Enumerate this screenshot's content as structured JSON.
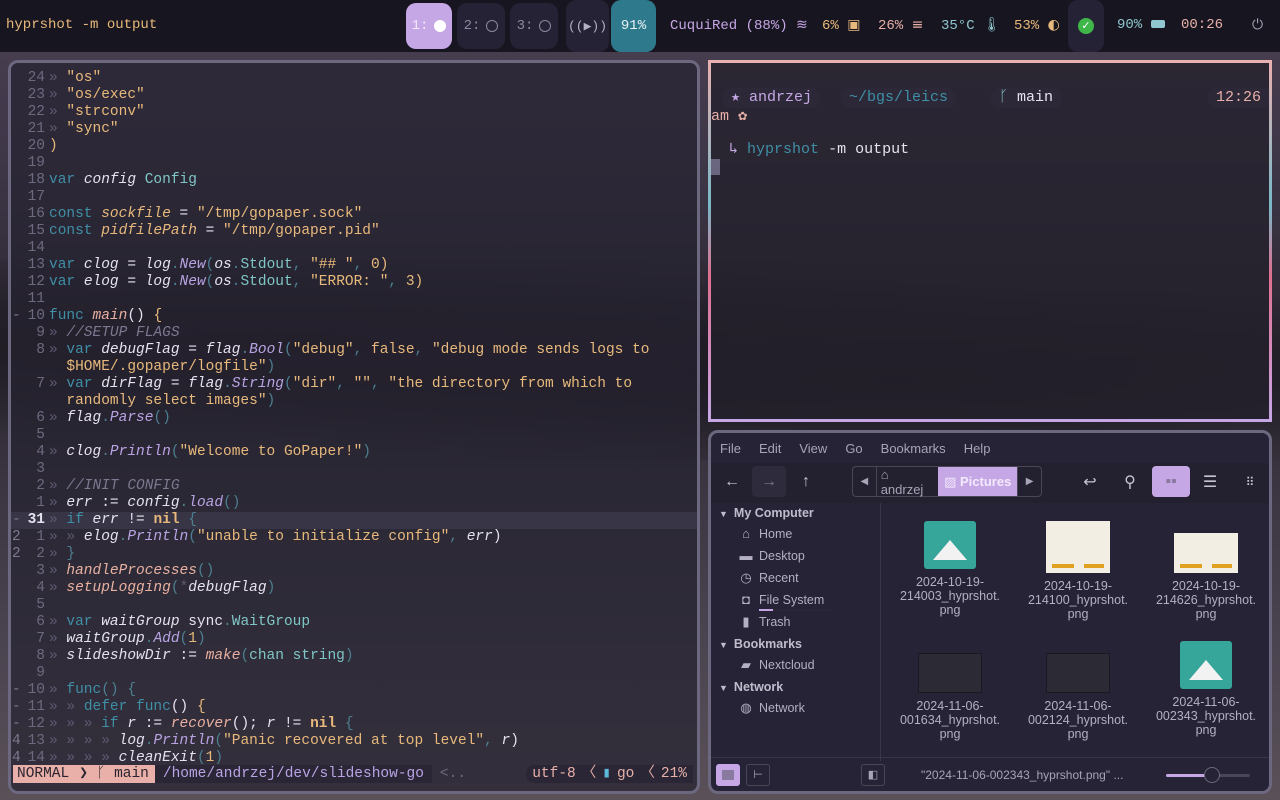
{
  "topbar": {
    "title": "hyprshot -m output",
    "workspaces": [
      {
        "label": "1:",
        "active": true
      },
      {
        "label": "2:",
        "active": false
      },
      {
        "label": "3:",
        "active": false
      }
    ],
    "media_icon": "media-play-icon",
    "volume": "91%",
    "wifi": "CuquiRed (88%)",
    "cpu": "6%",
    "memory": "26%",
    "temperature": "35°C",
    "brightness": "53%",
    "battery": "90%",
    "clock": "00:26",
    "colors": {
      "accent": "#c6a7e6",
      "volume_bg": "#2e7a8c",
      "bar_bg": "#17151f"
    }
  },
  "editor": {
    "lines": [
      {
        "n": "24",
        "f": "",
        "html": [
          [
            "arrow",
            "» "
          ],
          [
            "str",
            "\"os\""
          ]
        ]
      },
      {
        "n": "23",
        "f": "",
        "html": [
          [
            "arrow",
            "» "
          ],
          [
            "str",
            "\"os/exec\""
          ]
        ]
      },
      {
        "n": "22",
        "f": "",
        "html": [
          [
            "arrow",
            "» "
          ],
          [
            "str",
            "\"strconv\""
          ]
        ]
      },
      {
        "n": "21",
        "f": "",
        "html": [
          [
            "arrow",
            "» "
          ],
          [
            "str",
            "\"sync\""
          ]
        ]
      },
      {
        "n": "20",
        "f": "",
        "html": [
          [
            "str",
            ")"
          ]
        ]
      },
      {
        "n": "19",
        "f": "",
        "html": []
      },
      {
        "n": "18",
        "f": "",
        "html": [
          [
            "kw",
            "var "
          ],
          [
            "var",
            "config "
          ],
          [
            "typ",
            "Config"
          ]
        ]
      },
      {
        "n": "17",
        "f": "",
        "html": []
      },
      {
        "n": "16",
        "f": "",
        "html": [
          [
            "kw",
            "const "
          ],
          [
            "gl",
            "sockfile"
          ],
          [
            "txt",
            " = "
          ],
          [
            "str",
            "\"/tmp/gopaper.sock\""
          ]
        ]
      },
      {
        "n": "15",
        "f": "",
        "html": [
          [
            "kw",
            "const "
          ],
          [
            "gl",
            "pidfilePath"
          ],
          [
            "txt",
            " = "
          ],
          [
            "str",
            "\"/tmp/gopaper.pid\""
          ]
        ]
      },
      {
        "n": "14",
        "f": "",
        "html": []
      },
      {
        "n": "13",
        "f": "",
        "html": [
          [
            "kw",
            "var "
          ],
          [
            "var",
            "clog"
          ],
          [
            "txt",
            " = "
          ],
          [
            "var",
            "log"
          ],
          [
            "par",
            "."
          ],
          [
            "fn",
            "New"
          ],
          [
            "par",
            "("
          ],
          [
            "var",
            "os"
          ],
          [
            "par",
            "."
          ],
          [
            "typ",
            "Stdout"
          ],
          [
            "par",
            ", "
          ],
          [
            "str",
            "\"## \""
          ],
          [
            "par",
            ", "
          ],
          [
            "str",
            "0"
          ],
          [
            "str",
            ")"
          ]
        ]
      },
      {
        "n": "12",
        "f": "",
        "html": [
          [
            "kw",
            "var "
          ],
          [
            "var",
            "elog"
          ],
          [
            "txt",
            " = "
          ],
          [
            "var",
            "log"
          ],
          [
            "par",
            "."
          ],
          [
            "fn",
            "New"
          ],
          [
            "par",
            "("
          ],
          [
            "var",
            "os"
          ],
          [
            "par",
            "."
          ],
          [
            "typ",
            "Stdout"
          ],
          [
            "par",
            ", "
          ],
          [
            "str",
            "\"ERROR: \""
          ],
          [
            "par",
            ", "
          ],
          [
            "str",
            "3"
          ],
          [
            "str",
            ")"
          ]
        ]
      },
      {
        "n": "11",
        "f": "",
        "html": []
      },
      {
        "n": "10",
        "f": "-",
        "html": [
          [
            "kw",
            "func "
          ],
          [
            "call",
            "main"
          ],
          [
            "txt",
            "() "
          ],
          [
            "str",
            "{"
          ]
        ]
      },
      {
        "n": "9",
        "f": "",
        "html": [
          [
            "arrow",
            "» "
          ],
          [
            "cm",
            "//SETUP FLAGS"
          ]
        ]
      },
      {
        "n": "8",
        "f": "",
        "html": [
          [
            "arrow",
            "» "
          ],
          [
            "kw",
            "var "
          ],
          [
            "var",
            "debugFlag"
          ],
          [
            "txt",
            " = "
          ],
          [
            "var",
            "flag"
          ],
          [
            "par",
            "."
          ],
          [
            "fn",
            "Bool"
          ],
          [
            "par",
            "("
          ],
          [
            "str",
            "\"debug\""
          ],
          [
            "par",
            ", "
          ],
          [
            "str",
            "false"
          ],
          [
            "par",
            ", "
          ],
          [
            "str",
            "\"debug mode sends logs to"
          ]
        ]
      },
      {
        "n": "",
        "f": "",
        "html": [
          [
            "txt",
            "  "
          ],
          [
            "str",
            "$HOME/.gopaper/logfile\""
          ],
          [
            "par",
            ")"
          ]
        ]
      },
      {
        "n": "7",
        "f": "",
        "html": [
          [
            "arrow",
            "» "
          ],
          [
            "kw",
            "var "
          ],
          [
            "var",
            "dirFlag"
          ],
          [
            "txt",
            " = "
          ],
          [
            "var",
            "flag"
          ],
          [
            "par",
            "."
          ],
          [
            "fn",
            "String"
          ],
          [
            "par",
            "("
          ],
          [
            "str",
            "\"dir\""
          ],
          [
            "par",
            ", "
          ],
          [
            "str",
            "\"\""
          ],
          [
            "par",
            ", "
          ],
          [
            "str",
            "\"the directory from which to"
          ]
        ]
      },
      {
        "n": "",
        "f": "",
        "html": [
          [
            "txt",
            "  "
          ],
          [
            "str",
            "randomly select images\""
          ],
          [
            "par",
            ")"
          ]
        ]
      },
      {
        "n": "6",
        "f": "",
        "html": [
          [
            "arrow",
            "» "
          ],
          [
            "var",
            "flag"
          ],
          [
            "par",
            "."
          ],
          [
            "fn",
            "Parse"
          ],
          [
            "par",
            "()"
          ]
        ]
      },
      {
        "n": "5",
        "f": "",
        "html": []
      },
      {
        "n": "4",
        "f": "",
        "html": [
          [
            "arrow",
            "» "
          ],
          [
            "var",
            "clog"
          ],
          [
            "par",
            "."
          ],
          [
            "fn",
            "Println"
          ],
          [
            "par",
            "("
          ],
          [
            "str",
            "\"Welcome to GoPaper!\""
          ],
          [
            "par",
            ")"
          ]
        ]
      },
      {
        "n": "3",
        "f": "",
        "html": []
      },
      {
        "n": "2",
        "f": "",
        "html": [
          [
            "arrow",
            "» "
          ],
          [
            "cm",
            "//INIT CONFIG"
          ]
        ]
      },
      {
        "n": "1",
        "f": "",
        "html": [
          [
            "arrow",
            "» "
          ],
          [
            "var",
            "err"
          ],
          [
            "txt",
            " := "
          ],
          [
            "var",
            "config"
          ],
          [
            "par",
            "."
          ],
          [
            "fn",
            "load"
          ],
          [
            "par",
            "()"
          ]
        ]
      },
      {
        "n": "31",
        "f": "-",
        "cur": true,
        "html": [
          [
            "arrow",
            "» "
          ],
          [
            "kw",
            "if "
          ],
          [
            "var",
            "err"
          ],
          [
            "txt",
            " != "
          ],
          [
            "bool",
            "nil"
          ],
          [
            "par",
            " {"
          ]
        ]
      },
      {
        "n": "1",
        "f": "2",
        "html": [
          [
            "arrow",
            "» » "
          ],
          [
            "var",
            "elog"
          ],
          [
            "par",
            "."
          ],
          [
            "fn",
            "Println"
          ],
          [
            "par",
            "("
          ],
          [
            "str",
            "\"unable to initialize config\""
          ],
          [
            "par",
            ", "
          ],
          [
            "var",
            "err"
          ],
          [
            "txt",
            ")"
          ]
        ]
      },
      {
        "n": "2",
        "f": "2",
        "html": [
          [
            "arrow",
            "» "
          ],
          [
            "par",
            "}"
          ]
        ]
      },
      {
        "n": "3",
        "f": "",
        "html": [
          [
            "arrow",
            "» "
          ],
          [
            "call",
            "handleProcesses"
          ],
          [
            "par",
            "()"
          ]
        ]
      },
      {
        "n": "4",
        "f": "",
        "html": [
          [
            "arrow",
            "» "
          ],
          [
            "call",
            "setupLogging"
          ],
          [
            "par",
            "("
          ],
          [
            "arrow",
            "*"
          ],
          [
            "var",
            "debugFlag"
          ],
          [
            "par",
            ")"
          ]
        ]
      },
      {
        "n": "5",
        "f": "",
        "html": []
      },
      {
        "n": "6",
        "f": "",
        "html": [
          [
            "arrow",
            "» "
          ],
          [
            "kw",
            "var "
          ],
          [
            "var",
            "waitGroup "
          ],
          [
            "txt",
            "sync"
          ],
          [
            "par",
            "."
          ],
          [
            "typ",
            "WaitGroup"
          ]
        ]
      },
      {
        "n": "7",
        "f": "",
        "html": [
          [
            "arrow",
            "» "
          ],
          [
            "var",
            "waitGroup"
          ],
          [
            "par",
            "."
          ],
          [
            "fn",
            "Add"
          ],
          [
            "par",
            "("
          ],
          [
            "str",
            "1"
          ],
          [
            "par",
            ")"
          ]
        ]
      },
      {
        "n": "8",
        "f": "",
        "html": [
          [
            "arrow",
            "» "
          ],
          [
            "var",
            "slideshowDir"
          ],
          [
            "txt",
            " := "
          ],
          [
            "call",
            "make"
          ],
          [
            "par",
            "("
          ],
          [
            "typ",
            "chan string"
          ],
          [
            "par",
            ")"
          ]
        ]
      },
      {
        "n": "9",
        "f": "",
        "html": []
      },
      {
        "n": "10",
        "f": "-",
        "html": [
          [
            "arrow",
            "» "
          ],
          [
            "kw",
            "func"
          ],
          [
            "par",
            "() {"
          ]
        ]
      },
      {
        "n": "11",
        "f": "-",
        "html": [
          [
            "arrow",
            "» » "
          ],
          [
            "kw",
            "defer func"
          ],
          [
            "txt",
            "() "
          ],
          [
            "str",
            "{"
          ]
        ]
      },
      {
        "n": "12",
        "f": "-",
        "html": [
          [
            "arrow",
            "» » » "
          ],
          [
            "kw",
            "if "
          ],
          [
            "var",
            "r"
          ],
          [
            "txt",
            " := "
          ],
          [
            "call",
            "recover"
          ],
          [
            "txt",
            "(); "
          ],
          [
            "var",
            "r"
          ],
          [
            "txt",
            " != "
          ],
          [
            "bool",
            "nil"
          ],
          [
            "par",
            " {"
          ]
        ]
      },
      {
        "n": "13",
        "f": "4",
        "html": [
          [
            "arrow",
            "» » » » "
          ],
          [
            "var",
            "log"
          ],
          [
            "par",
            "."
          ],
          [
            "fn",
            "Println"
          ],
          [
            "par",
            "("
          ],
          [
            "str",
            "\"Panic recovered at top level\""
          ],
          [
            "par",
            ", "
          ],
          [
            "var",
            "r"
          ],
          [
            "txt",
            ")"
          ]
        ]
      },
      {
        "n": "14",
        "f": "4",
        "html": [
          [
            "arrow",
            "» » » » "
          ],
          [
            "var",
            "cleanExit"
          ],
          [
            "par",
            "("
          ],
          [
            "str",
            "1"
          ],
          [
            "par",
            ")"
          ]
        ]
      }
    ],
    "status": {
      "mode": "NORMAL",
      "branch": "main",
      "path": "/home/andrzej/dev/slideshow-go",
      "trunc": "<..",
      "encoding": "utf-8",
      "filetype": "go",
      "percent": "21%"
    }
  },
  "terminal": {
    "user": "andrzej",
    "cwd": "~/bgs/leics",
    "branch": "main",
    "time": "12:26",
    "time_suffix": "am",
    "command_bin": "hyprshot",
    "command_args": "-m output"
  },
  "filemanager": {
    "menu": [
      "File",
      "Edit",
      "View",
      "Go",
      "Bookmarks",
      "Help"
    ],
    "crumbs": {
      "home": "andrzej",
      "current": "Pictures"
    },
    "sidebar": {
      "sections": [
        {
          "title": "My Computer",
          "items": [
            {
              "label": "Home",
              "icon": "home-icon"
            },
            {
              "label": "Desktop",
              "icon": "desktop-icon"
            },
            {
              "label": "Recent",
              "icon": "clock-icon"
            },
            {
              "label": "File System",
              "icon": "drive-icon"
            },
            {
              "label": "Trash",
              "icon": "trash-icon"
            }
          ]
        },
        {
          "title": "Bookmarks",
          "items": [
            {
              "label": "Nextcloud",
              "icon": "folder-icon"
            }
          ]
        },
        {
          "title": "Network",
          "items": [
            {
              "label": "Network",
              "icon": "globe-icon"
            }
          ]
        }
      ]
    },
    "files": [
      {
        "name1": "2024-10-19-",
        "name2": "214003_hyprshot.",
        "name3": "png",
        "thumb": "generic"
      },
      {
        "name1": "2024-10-19-",
        "name2": "214100_hyprshot.",
        "name3": "png",
        "thumb": "doc"
      },
      {
        "name1": "2024-10-19-",
        "name2": "214626_hyprshot.",
        "name3": "png",
        "thumb": "doc"
      },
      {
        "name1": "2024-11-06-",
        "name2": "001634_hyprshot.",
        "name3": "png",
        "thumb": "screen"
      },
      {
        "name1": "2024-11-06-",
        "name2": "002124_hyprshot.",
        "name3": "png",
        "thumb": "screen"
      },
      {
        "name1": "2024-11-06-",
        "name2": "002343_hyprshot.",
        "name3": "png",
        "thumb": "generic"
      }
    ],
    "status_text": "\"2024-11-06-002343_hyprshot.png\" ...",
    "zoom_level": 0.55
  }
}
